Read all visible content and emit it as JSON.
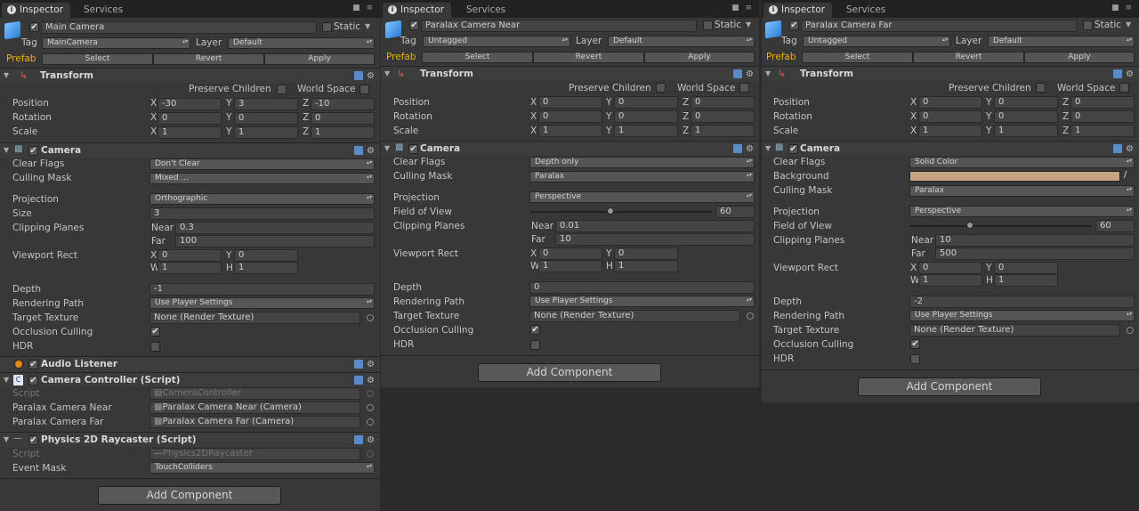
{
  "common": {
    "tab_inspector": "Inspector",
    "tab_services": "Services",
    "static": "Static",
    "tag": "Tag",
    "layer": "Layer",
    "prefab": "Prefab",
    "select": "Select",
    "revert": "Revert",
    "apply": "Apply",
    "transform": "Transform",
    "preserve_children": "Preserve Children",
    "world_space": "World Space",
    "position": "Position",
    "rotation": "Rotation",
    "scale": "Scale",
    "x": "X",
    "y": "Y",
    "z": "Z",
    "w": "W",
    "h": "H",
    "near": "Near",
    "far": "Far",
    "camera": "Camera",
    "clear_flags": "Clear Flags",
    "background": "Background",
    "culling_mask": "Culling Mask",
    "projection": "Projection",
    "size": "Size",
    "field_of_view": "Field of View",
    "clipping_planes": "Clipping Planes",
    "viewport_rect": "Viewport Rect",
    "depth": "Depth",
    "rendering_path": "Rendering Path",
    "target_texture": "Target Texture",
    "occlusion_culling": "Occlusion Culling",
    "hdr": "HDR",
    "add_component": "Add Component",
    "checkmark": "✔"
  },
  "panels": [
    {
      "name": "Main Camera",
      "tag_value": "MainCamera",
      "layer_value": "Default",
      "position": [
        "-30",
        "3",
        "-10"
      ],
      "rotation": [
        "0",
        "0",
        "0"
      ],
      "scale": [
        "1",
        "1",
        "1"
      ],
      "clear_flags": "Don't Clear",
      "culling_mask": "Mixed ...",
      "projection": "Orthographic",
      "size": "3",
      "near": "0.3",
      "far": "100",
      "viewport": [
        "0",
        "0",
        "1",
        "1"
      ],
      "depth": "-1",
      "rendering_path": "Use Player Settings",
      "target_texture": "None (Render Texture)",
      "audio_listener": "Audio Listener",
      "camera_controller": {
        "title": "Camera Controller (Script)",
        "script_label": "Script",
        "script_value": "CameraController",
        "near_label": "Paralax Camera Near",
        "near_value": "Paralax Camera Near (Camera)",
        "far_label": "Paralax Camera Far",
        "far_value": "Paralax Camera Far (Camera)"
      },
      "raycaster": {
        "title": "Physics 2D Raycaster (Script)",
        "script_label": "Script",
        "script_value": "Physics2DRaycaster",
        "mask_label": "Event Mask",
        "mask_value": "TouchColliders"
      }
    },
    {
      "name": "Paralax Camera Near",
      "tag_value": "Untagged",
      "layer_value": "Default",
      "position": [
        "0",
        "0",
        "0"
      ],
      "rotation": [
        "0",
        "0",
        "0"
      ],
      "scale": [
        "1",
        "1",
        "1"
      ],
      "clear_flags": "Depth only",
      "culling_mask": "Paralax",
      "projection": "Perspective",
      "fov": "60",
      "fov_fraction": 0.44,
      "near": "0.01",
      "far": "10",
      "viewport": [
        "0",
        "0",
        "1",
        "1"
      ],
      "depth": "0",
      "rendering_path": "Use Player Settings",
      "target_texture": "None (Render Texture)"
    },
    {
      "name": "Paralax Camera Far",
      "tag_value": "Untagged",
      "layer_value": "Default",
      "position": [
        "0",
        "0",
        "0"
      ],
      "rotation": [
        "0",
        "0",
        "0"
      ],
      "scale": [
        "1",
        "1",
        "1"
      ],
      "clear_flags": "Solid Color",
      "background_color": "#c8a57e",
      "culling_mask": "Paralax",
      "projection": "Perspective",
      "fov": "60",
      "fov_fraction": 0.33,
      "near": "10",
      "far": "500",
      "viewport": [
        "0",
        "0",
        "1",
        "1"
      ],
      "depth": "-2",
      "rendering_path": "Use Player Settings",
      "target_texture": "None (Render Texture)"
    }
  ]
}
